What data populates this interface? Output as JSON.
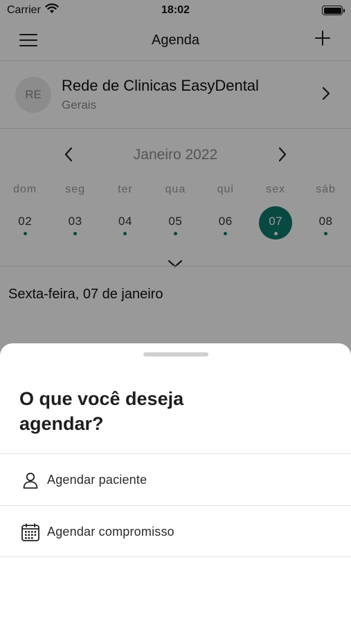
{
  "status_bar": {
    "carrier": "Carrier",
    "time": "18:02"
  },
  "nav": {
    "title": "Agenda",
    "menu_icon": "hamburger-menu-icon",
    "add_icon": "plus-icon"
  },
  "clinic": {
    "initials": "RE",
    "name": "Rede de Clinicas EasyDental",
    "subtitle": "Gerais"
  },
  "calendar": {
    "month": "Janeiro 2022",
    "weekdays": [
      "dom",
      "seg",
      "ter",
      "qua",
      "qui",
      "sex",
      "sáb"
    ],
    "days": [
      "02",
      "03",
      "04",
      "05",
      "06",
      "07",
      "08"
    ],
    "selected_day": "07",
    "accent_color": "#0e7a6d"
  },
  "selected_date_label": "Sexta-feira, 07 de janeiro",
  "sheet": {
    "title": "O que você deseja agendar?",
    "options": [
      {
        "label": "Agendar paciente",
        "icon": "person-icon"
      },
      {
        "label": "Agendar compromisso",
        "icon": "calendar-icon"
      }
    ]
  }
}
